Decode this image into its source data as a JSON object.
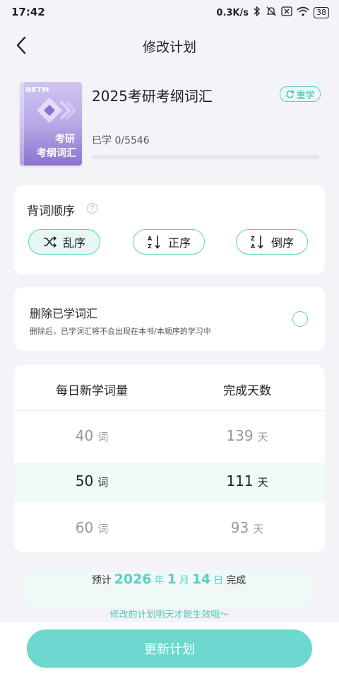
{
  "status": {
    "time": "17:42",
    "speed": "0.3K/s",
    "battery": "38"
  },
  "nav": {
    "title": "修改计划"
  },
  "book": {
    "badge": "NETM",
    "cover_line1": "考研",
    "cover_line2": "考纲词汇",
    "color": "#9b86d8"
  },
  "vocab": {
    "title": "2025考研考纲词汇",
    "relearn_label": "重学",
    "learned_text": "已学 0/5546",
    "progress": 0
  },
  "order": {
    "title": "背词顺序",
    "options": [
      {
        "label": "乱序",
        "icon": "shuffle-icon",
        "selected": true
      },
      {
        "label": "正序",
        "icon": "sort-az-icon",
        "selected": false
      },
      {
        "label": "倒序",
        "icon": "sort-za-icon",
        "selected": false
      }
    ]
  },
  "delete": {
    "title": "删除已学词汇",
    "desc": "删除后，已学词汇将不会出现在本书/本顺序的学习中",
    "checked": false
  },
  "plan": {
    "col_daily": "每日新学词量",
    "col_days": "完成天数",
    "word_unit": "词",
    "day_unit": "天",
    "rows": [
      {
        "words": "40",
        "days": "139",
        "selected": false
      },
      {
        "words": "50",
        "days": "111",
        "selected": true
      },
      {
        "words": "60",
        "days": "93",
        "selected": false
      }
    ]
  },
  "finish": {
    "prefix": "预计",
    "year": "2026",
    "year_unit": "年",
    "month": "1",
    "month_unit": "月",
    "day": "14",
    "day_unit": "日",
    "suffix": "完成"
  },
  "note": "修改的计划明天才能生效哦～",
  "update_button": "更新计划",
  "colors": {
    "accent": "#5ccfc3",
    "button": "#6dd8cd",
    "background": "#f4f4f8"
  }
}
